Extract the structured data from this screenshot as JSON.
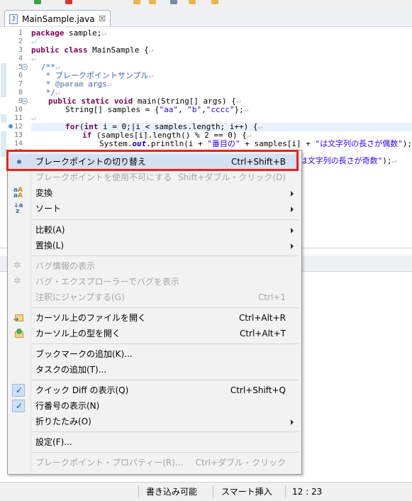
{
  "editor_tab": {
    "label": "MainSample.java",
    "close": "☒"
  },
  "code_lines": [
    {
      "n": "1",
      "t": "package sample;"
    },
    {
      "n": "2",
      "t": ""
    },
    {
      "n": "3",
      "t": "public class MainSample {"
    },
    {
      "n": "4",
      "t": ""
    },
    {
      "n": "5",
      "t": "/**"
    },
    {
      "n": "6",
      "t": " * ブレークポイントサンプル"
    },
    {
      "n": "7",
      "t": " * @param args"
    },
    {
      "n": "8",
      "t": " */"
    },
    {
      "n": "9",
      "t": "public static void main(String[] args) {"
    },
    {
      "n": "10",
      "t": "String[] samples = {\"aa\", \"b\",\"cccc\"};"
    },
    {
      "n": "11",
      "t": ""
    },
    {
      "n": "12",
      "t": "for(int i = 0;|i < samples.length; i++) {"
    },
    {
      "n": "13",
      "t": "if (samples[i].length() % 2 == 0) {"
    },
    {
      "n": "14",
      "t": "System.out.println(i + \"番目の\" + samples[i] + \"は文字列の長さが偶数\");"
    },
    {
      "n": "15",
      "t": "\"は文字列の長さが奇数\");"
    }
  ],
  "context_menu": {
    "items": [
      {
        "label": "ブレークポイントの切り替え",
        "accel": "Ctrl+Shift+B"
      },
      {
        "label": "ブレークポイントを使用不可にする",
        "accel": "Shift+ダブル・クリック(D)"
      },
      {
        "label": "変換",
        "accel": ""
      },
      {
        "label": "ソート",
        "accel": ""
      },
      {
        "label": "比較(A)",
        "accel": ""
      },
      {
        "label": "置換(L)",
        "accel": ""
      },
      {
        "label": "バグ情報の表示",
        "accel": ""
      },
      {
        "label": "バグ・エクスプローラーでバグを表示",
        "accel": ""
      },
      {
        "label": "注釈にジャンプする(G)",
        "accel": "Ctrl+1"
      },
      {
        "label": "カーソル上のファイルを開く",
        "accel": "Ctrl+Alt+R"
      },
      {
        "label": "カーソル上の型を開く",
        "accel": "Ctrl+Alt+T"
      },
      {
        "label": "ブックマークの追加(K)...",
        "accel": ""
      },
      {
        "label": "タスクの追加(T)...",
        "accel": ""
      },
      {
        "label": "クイック Diff の表示(Q)",
        "accel": "Ctrl+Shift+Q"
      },
      {
        "label": "行番号の表示(N)",
        "accel": ""
      },
      {
        "label": "折りたたみ(O)",
        "accel": ""
      },
      {
        "label": "設定(F)...",
        "accel": ""
      },
      {
        "label": "ブレークポイント・プロパティー(R)...",
        "accel": "Ctrl+ダブル・クリック"
      }
    ]
  },
  "status_bar": {
    "writable": "書き込み可能",
    "insert_mode": "スマート挿入",
    "position": "12 : 23"
  },
  "colors": {
    "highlight_border": "#e8221c",
    "selected_bg": "#d5e1f2"
  }
}
